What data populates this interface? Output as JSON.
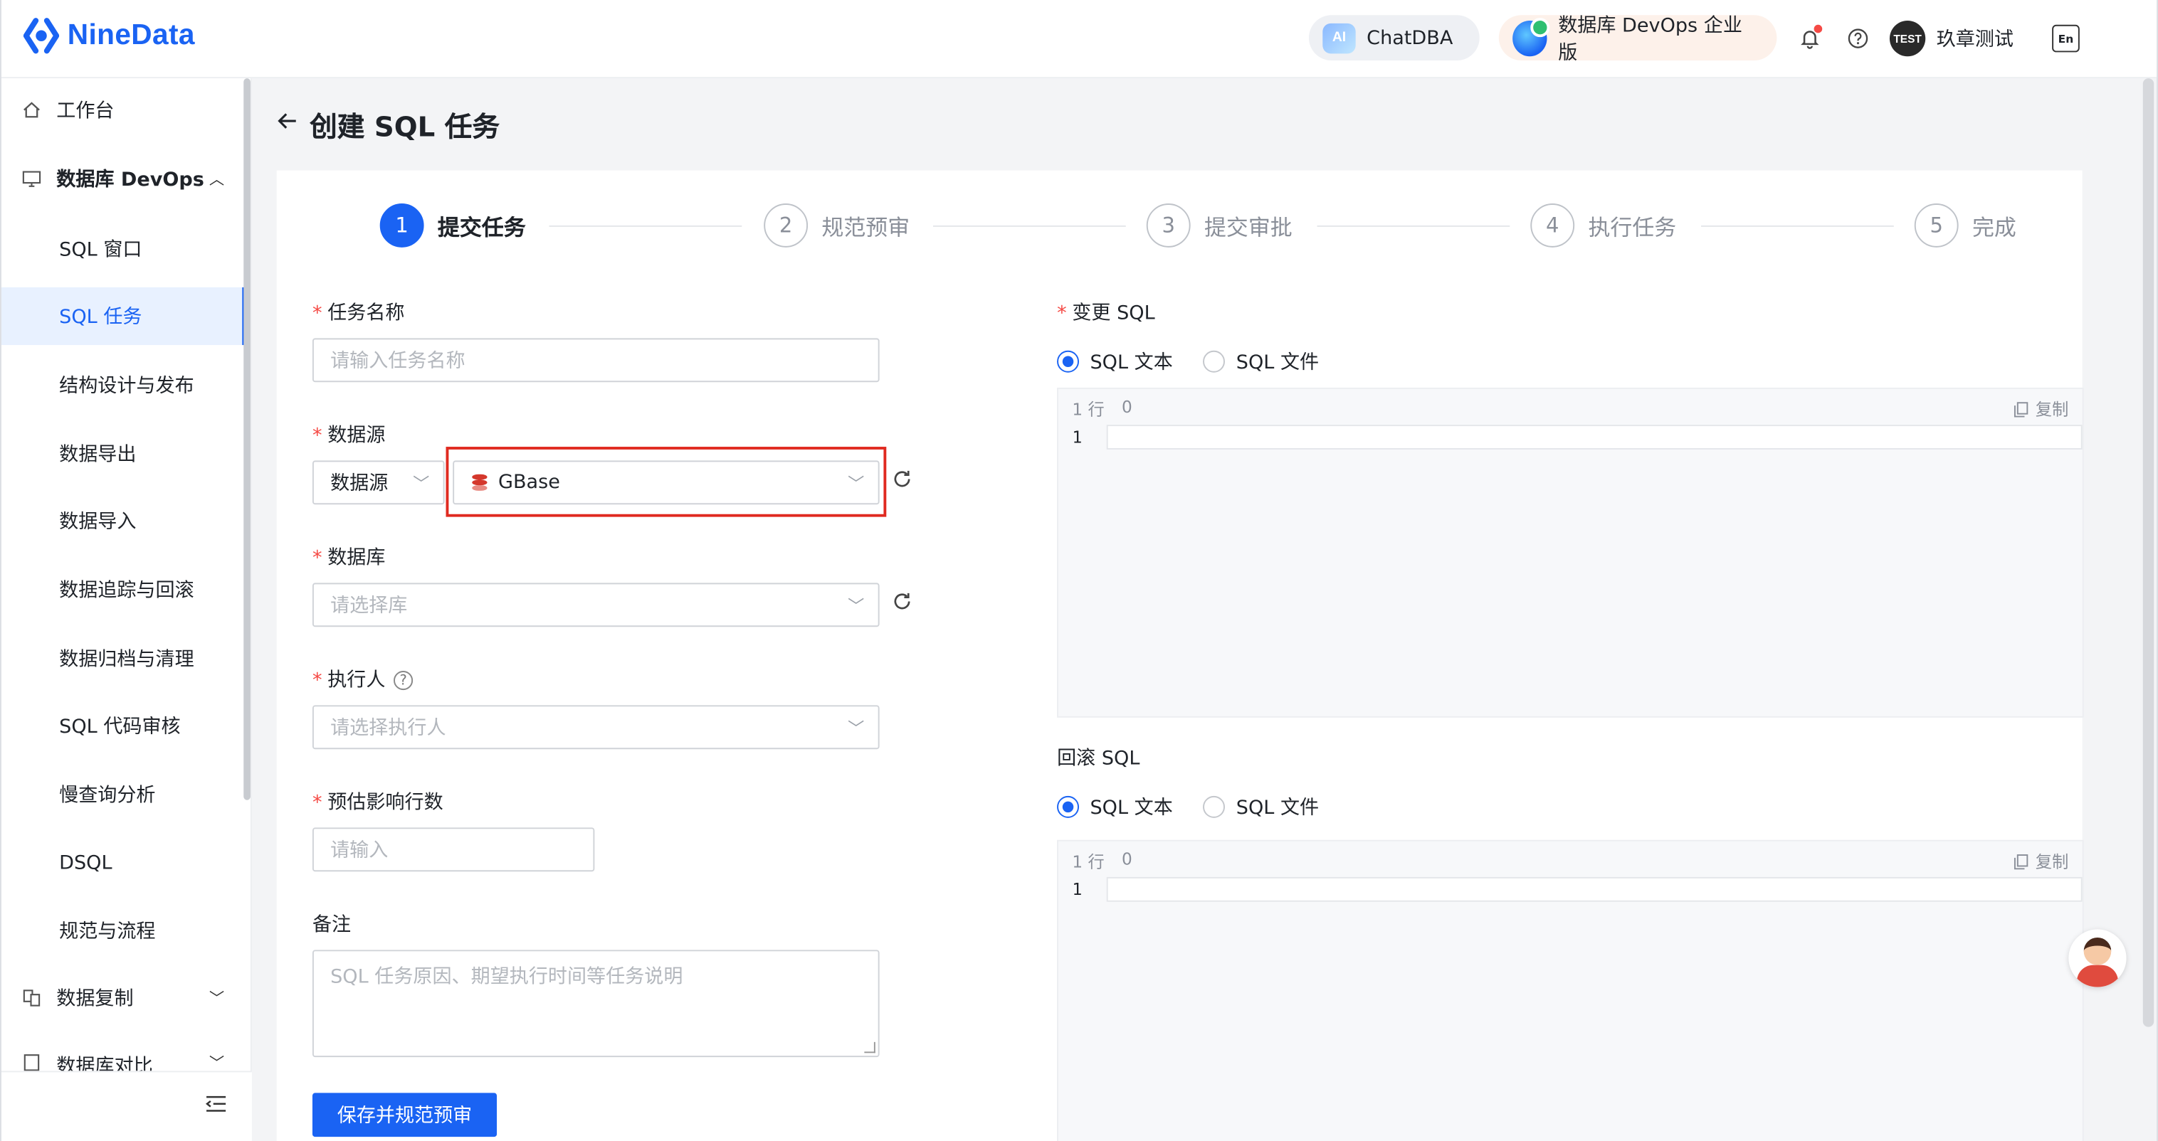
{
  "brand": {
    "name": "NineData"
  },
  "topbar": {
    "chat": "ChatDBA",
    "ai_badge": "AI",
    "edition": "数据库 DevOps 企业版",
    "avatar_text": "TEST",
    "user": "玖章测试",
    "lang_badge": "En"
  },
  "sidebar": {
    "items": [
      {
        "label": "工作台",
        "icon": "home-icon"
      },
      {
        "label": "数据库 DevOps",
        "icon": "monitor-sql-icon",
        "expanded": true
      },
      {
        "label": "SQL 窗口"
      },
      {
        "label": "SQL 任务",
        "active": true
      },
      {
        "label": "结构设计与发布"
      },
      {
        "label": "数据导出"
      },
      {
        "label": "数据导入"
      },
      {
        "label": "数据追踪与回滚"
      },
      {
        "label": "数据归档与清理"
      },
      {
        "label": "SQL 代码审核"
      },
      {
        "label": "慢查询分析"
      },
      {
        "label": "DSQL"
      },
      {
        "label": "规范与流程"
      },
      {
        "label": "数据复制",
        "icon": "replicate-icon"
      },
      {
        "label": "数据库对比",
        "icon": "compare-icon"
      }
    ]
  },
  "page": {
    "title": "创建 SQL 任务"
  },
  "steps": [
    {
      "num": "1",
      "label": "提交任务",
      "active": true
    },
    {
      "num": "2",
      "label": "规范预审"
    },
    {
      "num": "3",
      "label": "提交审批"
    },
    {
      "num": "4",
      "label": "执行任务"
    },
    {
      "num": "5",
      "label": "完成"
    }
  ],
  "form": {
    "task_name": {
      "label": "任务名称",
      "placeholder": "请输入任务名称"
    },
    "datasource": {
      "label": "数据源",
      "type_select": "数据源",
      "value": "GBase"
    },
    "database": {
      "label": "数据库",
      "placeholder": "请选择库"
    },
    "executor": {
      "label": "执行人",
      "placeholder": "请选择执行人",
      "help": "?"
    },
    "affected_rows": {
      "label": "预估影响行数",
      "placeholder": "请输入"
    },
    "remark": {
      "label": "备注",
      "placeholder": "SQL 任务原因、期望执行时间等任务说明"
    },
    "save_button": "保存并规范预审"
  },
  "change_sql": {
    "label": "变更 SQL",
    "options": [
      "SQL 文本",
      "SQL 文件"
    ],
    "selected": "SQL 文本",
    "editor": {
      "rows_label": "1 行",
      "count": "0",
      "copy": "复制",
      "line": "1"
    }
  },
  "rollback_sql": {
    "label": "回滚 SQL",
    "options": [
      "SQL 文本",
      "SQL 文件"
    ],
    "selected": "SQL 文本",
    "editor": {
      "rows_label": "1 行",
      "count": "0",
      "copy": "复制",
      "line": "1"
    }
  },
  "colors": {
    "primary": "#1a63f3",
    "required": "#f54a45",
    "highlight": "#e02a20"
  }
}
